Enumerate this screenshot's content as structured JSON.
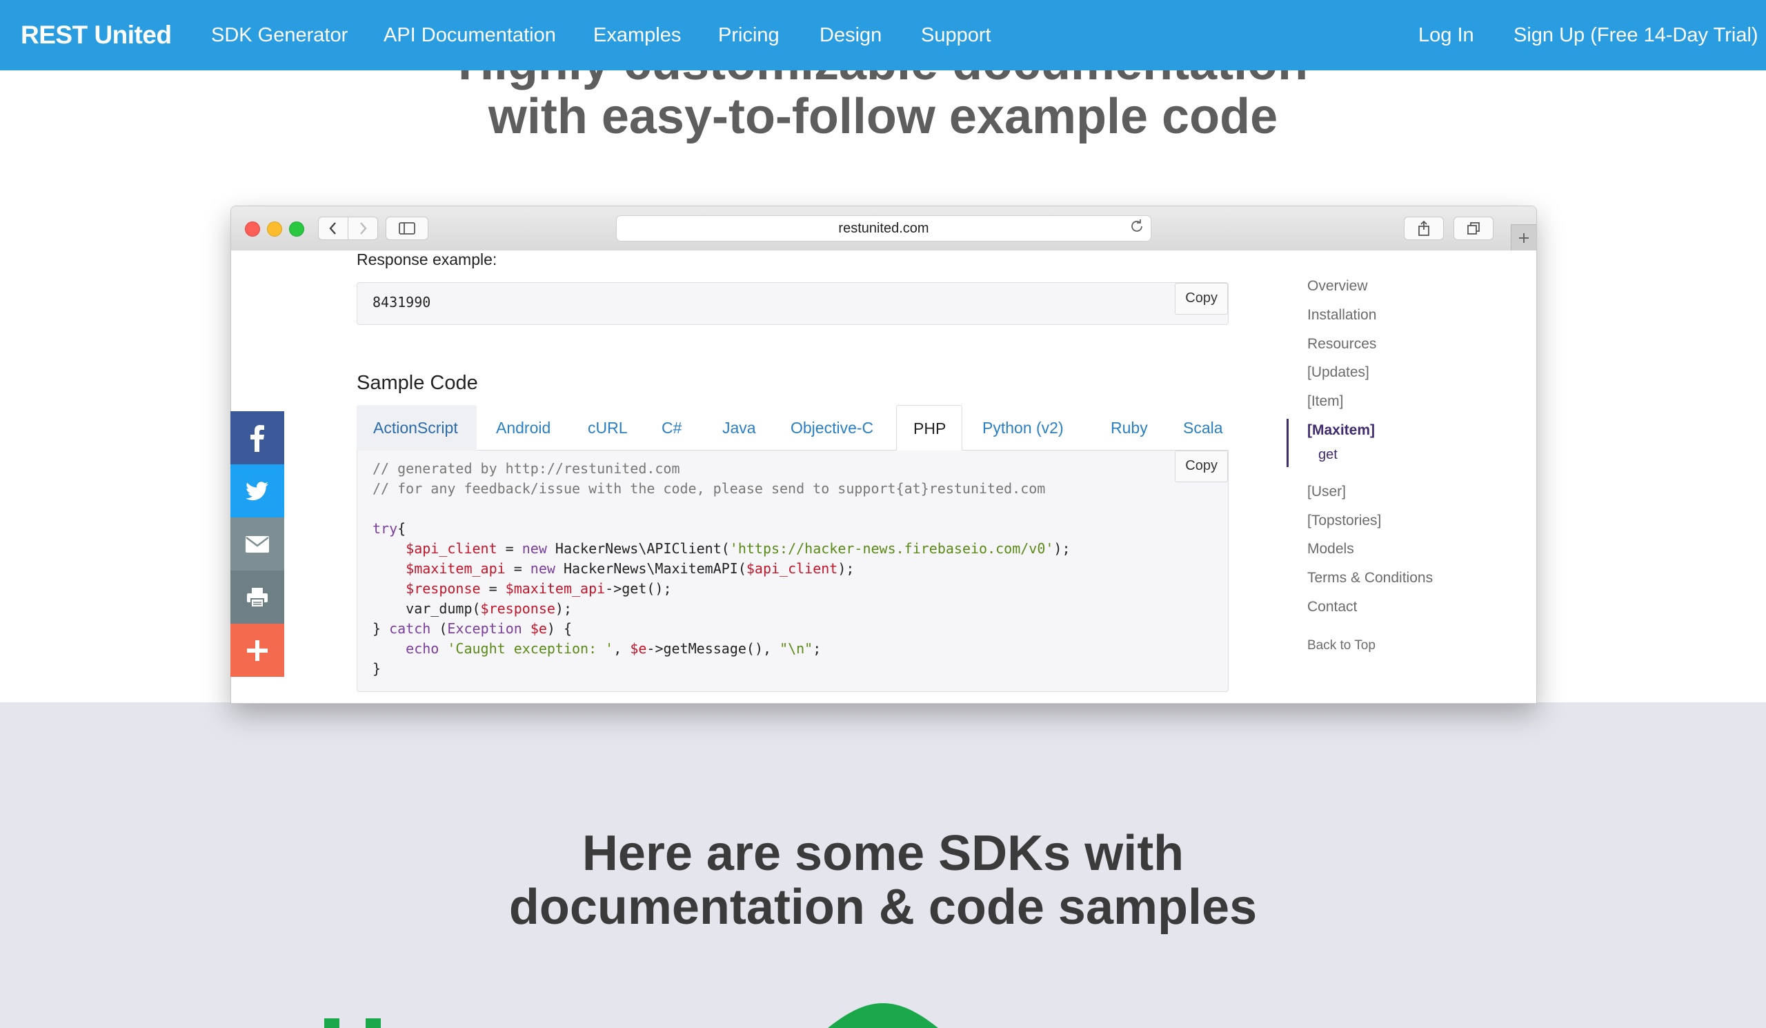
{
  "nav": {
    "brand": "REST United",
    "links": [
      "SDK Generator",
      "API Documentation",
      "Examples",
      "Pricing",
      "Design",
      "Support"
    ],
    "login": "Log In",
    "signup": "Sign Up (Free 14-Day Trial)"
  },
  "hero": {
    "line1": "Highly customizable documentation",
    "line2": "with easy-to-follow example code"
  },
  "browser": {
    "url": "restunited.com"
  },
  "doc": {
    "response_label": "Response example:",
    "response_value": "8431990",
    "copy_label": "Copy",
    "sample_title": "Sample Code",
    "tabs": [
      "ActionScript",
      "Android",
      "cURL",
      "C#",
      "Java",
      "Objective-C",
      "PHP",
      "Python (v2)",
      "Ruby",
      "Scala"
    ],
    "active_tab": "PHP",
    "code": {
      "comment1": "// generated by http://restunited.com",
      "comment2": "// for any feedback/issue with the code, please send to support{at}restunited.com",
      "try": "try",
      "var_api_client": "$api_client",
      "var_maxitem_api": "$maxitem_api",
      "var_response": "$response",
      "var_e": "$e",
      "kw_new": "new",
      "kw_catch": "catch",
      "kw_exception": "Exception",
      "kw_echo": "echo",
      "str_url": "'https://hacker-news.firebaseio.com/v0'",
      "str_caught": "'Caught exception: '",
      "str_newline": "\"\\n\"",
      "cls_apiclient": "HackerNews\\APIClient(",
      "cls_maxitemapi": "HackerNews\\MaxitemAPI(",
      "call_get": "->get();",
      "call_vardump": "var_dump(",
      "call_getmessage": "->getMessage(), "
    }
  },
  "toc": {
    "items": [
      "Overview",
      "Installation",
      "Resources",
      "[Updates]",
      "[Item]",
      "[Maxitem]",
      "get",
      "[User]",
      "[Topstories]",
      "Models",
      "Terms & Conditions",
      "Contact",
      "Back to Top"
    ],
    "active": "[Maxitem]"
  },
  "share": [
    "facebook-icon",
    "twitter-icon",
    "email-icon",
    "print-icon",
    "plus-icon"
  ],
  "colors": {
    "nav_bg": "#2a9de0",
    "facebook": "#3b5998",
    "twitter": "#1da1f2",
    "email": "#7d8f95",
    "print": "#6e8086",
    "more": "#f36a4f",
    "lower_bg": "#e5e5ed"
  },
  "lower": {
    "line1": "Here are some SDKs with",
    "line2": "documentation & code samples"
  }
}
